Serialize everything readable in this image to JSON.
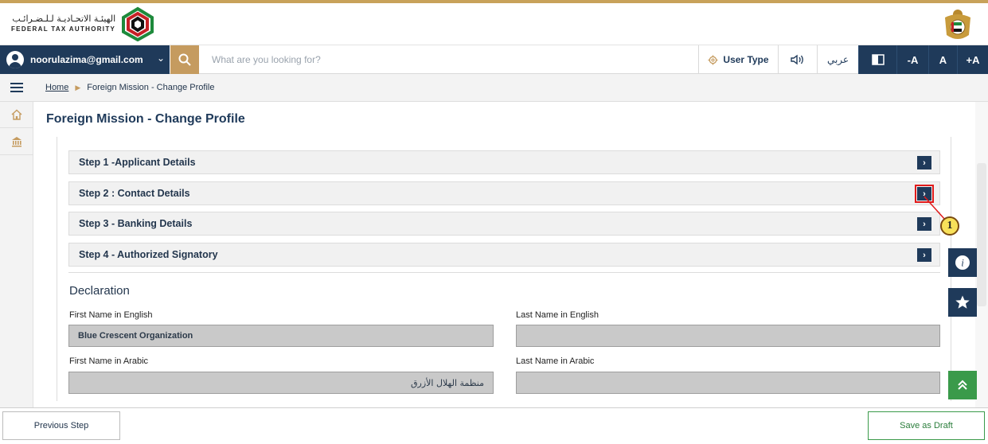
{
  "brand": {
    "name_ar": "الهيئـة الاتحـاديـة لـلـضـرائـب",
    "name_en": "FEDERAL TAX AUTHORITY"
  },
  "navbar": {
    "user_email": "noorulazima@gmail.com",
    "search_placeholder": "What are you looking for?",
    "user_type_label": "User Type",
    "language_label": "عربي",
    "font_decrease": "-A",
    "font_normal": "A",
    "font_increase": "+A"
  },
  "breadcrumb": {
    "home": "Home",
    "current": "Foreign Mission - Change Profile"
  },
  "page": {
    "title": "Foreign Mission - Change Profile"
  },
  "steps": [
    {
      "label": "Step 1 -Applicant Details"
    },
    {
      "label": "Step 2 : Contact Details"
    },
    {
      "label": "Step 3 - Banking Details"
    },
    {
      "label": "Step 4 - Authorized Signatory"
    }
  ],
  "callout": {
    "number": "1"
  },
  "declaration": {
    "title": "Declaration",
    "first_name_en_label": "First Name in English",
    "first_name_en_value": "Blue Crescent Organization",
    "last_name_en_label": "Last Name in English",
    "last_name_en_value": "",
    "first_name_ar_label": "First Name in Arabic",
    "first_name_ar_value": "منظمة الهلال الأزرق",
    "last_name_ar_label": "Last Name in Arabic",
    "last_name_ar_value": ""
  },
  "footer": {
    "previous_label": "Previous Step",
    "draft_label": "Save as Draft"
  },
  "colors": {
    "primary": "#1f3a5a",
    "accent_gold": "#c59b5f",
    "highlight_red": "#e11b1b",
    "success_green": "#3a9a4a"
  },
  "icons": [
    "user-avatar-icon",
    "search-icon",
    "gear-icon",
    "speaker-icon",
    "contrast-icon",
    "menu-icon",
    "home-icon",
    "bank-icon",
    "info-icon",
    "star-icon",
    "scroll-up-icon",
    "chevron-right-icon"
  ]
}
